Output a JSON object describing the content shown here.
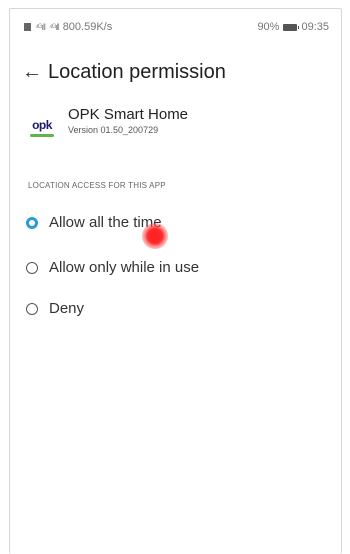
{
  "status_bar": {
    "speed": "800.59K/s",
    "battery": "90%",
    "time": "09:35",
    "signal1_icon": "signal-icon",
    "signal2_icon": "signal-icon"
  },
  "header": {
    "back_icon": "←",
    "title": "Location permission"
  },
  "app": {
    "logo_text": "opk",
    "name": "OPK Smart  Home",
    "version": "Version 01.50_200729"
  },
  "section_label": "LOCATION ACCESS FOR THIS APP",
  "options": [
    {
      "label": "Allow all the time",
      "selected": true
    },
    {
      "label": "Allow only while in use",
      "selected": false
    },
    {
      "label": "Deny",
      "selected": false
    }
  ],
  "colors": {
    "accent": "#2e9bd6",
    "tap_indicator": "#ff2020",
    "logo_green": "#5bb84a",
    "logo_text": "#1a1a6e"
  }
}
